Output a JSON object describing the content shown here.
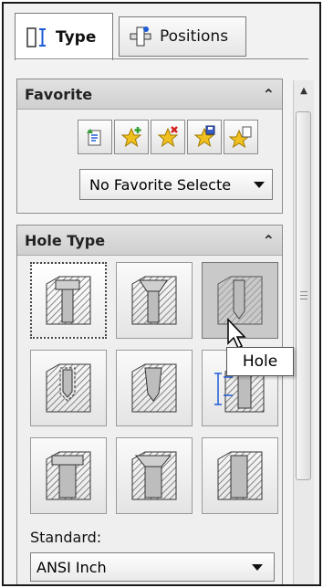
{
  "tabs": [
    {
      "label": "Type",
      "icon": "hole-type-icon",
      "active": true
    },
    {
      "label": "Positions",
      "icon": "positions-icon",
      "active": false
    }
  ],
  "favorite": {
    "title": "Favorite",
    "collapse_glyph": "≈",
    "toolbar_icons": [
      "apply-defaults-icon",
      "add-favorite-icon",
      "delete-favorite-icon",
      "save-favorite-icon",
      "load-favorite-icon"
    ],
    "selected": "No Favorite Selecte"
  },
  "hole_type": {
    "title": "Hole Type",
    "collapse_glyph": "≈",
    "buttons": [
      {
        "name": "counterbore",
        "selected": true
      },
      {
        "name": "countersink"
      },
      {
        "name": "hole",
        "hover": true
      },
      {
        "name": "straight-tap"
      },
      {
        "name": "tapered-tap"
      },
      {
        "name": "legacy"
      },
      {
        "name": "counterbore-slot"
      },
      {
        "name": "countersink-slot"
      },
      {
        "name": "slot"
      }
    ],
    "standard_label": "Standard:",
    "standard_value": "ANSI Inch"
  },
  "tooltip": "Hole",
  "colors": {
    "accent": "#f0c020",
    "panel_bg": "#efefef",
    "hatch": "#7a7a7a"
  }
}
